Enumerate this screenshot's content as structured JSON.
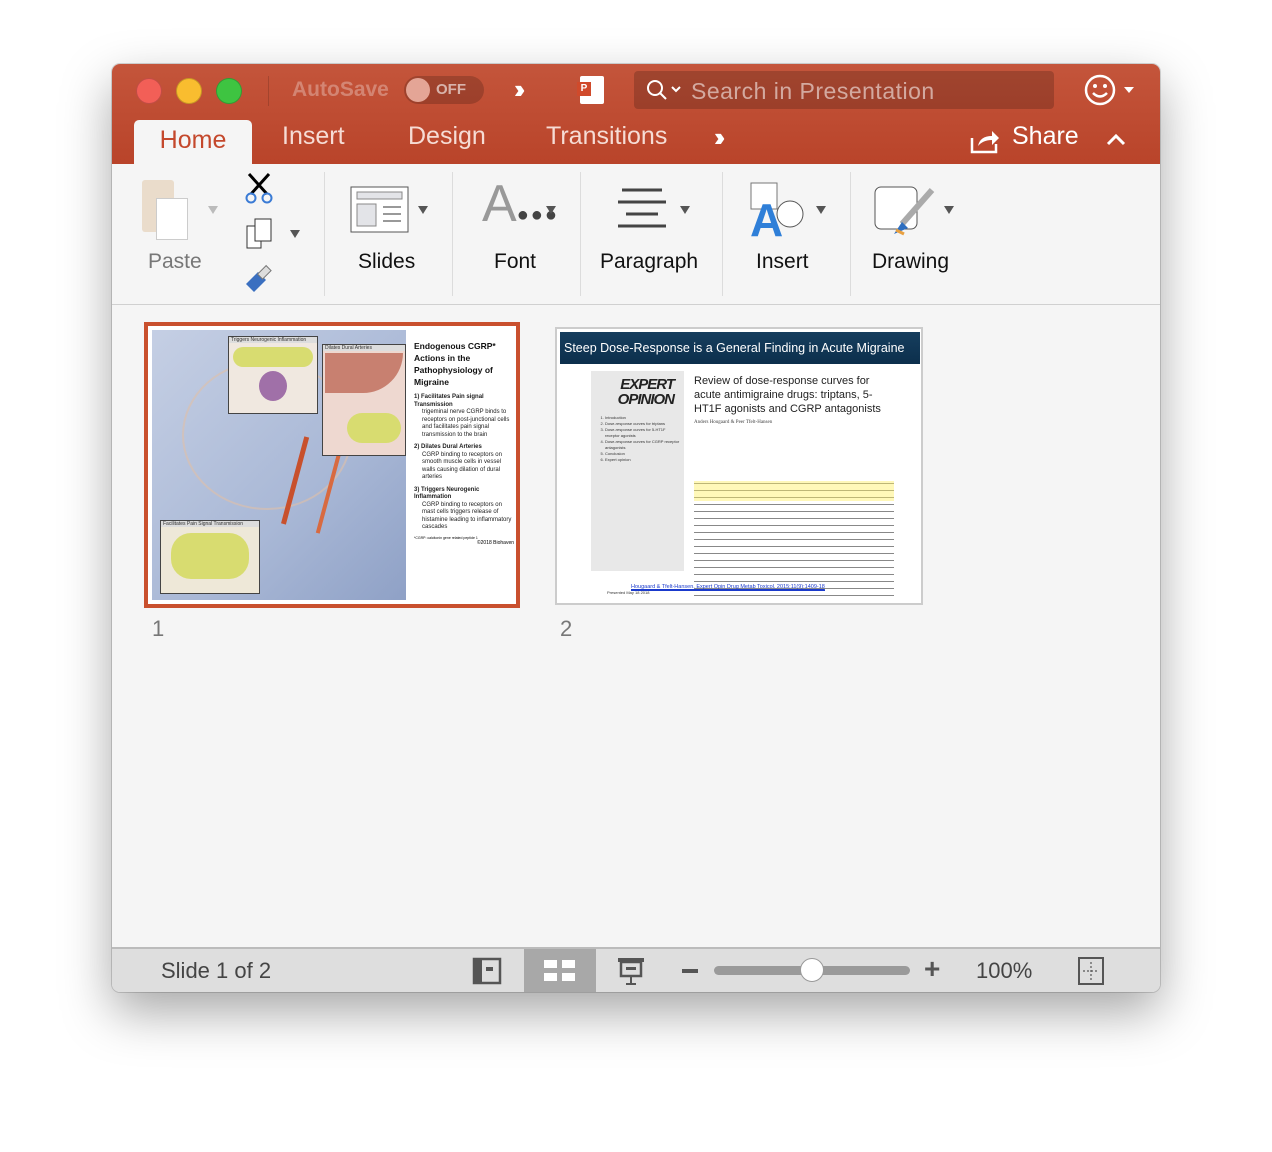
{
  "titlebar": {
    "autosave_label": "AutoSave",
    "autosave_state": "OFF",
    "search_placeholder": "Search in Presentation"
  },
  "tabs": [
    {
      "label": "Home",
      "active": true
    },
    {
      "label": "Insert"
    },
    {
      "label": "Design"
    },
    {
      "label": "Transitions"
    }
  ],
  "share_label": "Share",
  "ribbon": {
    "paste": "Paste",
    "slides": "Slides",
    "font": "Font",
    "paragraph": "Paragraph",
    "insert": "Insert",
    "drawing": "Drawing"
  },
  "slides": [
    {
      "number": "1",
      "selected": true,
      "title": "Endogenous CGRP* Actions in the Pathophysiology of Migraine",
      "points": [
        {
          "head": "1) Facilitates Pain signal Transmission",
          "body": "trigeminal nerve CGRP binds to receptors on post-junctional cells and facilitates pain signal transmission to the brain"
        },
        {
          "head": "2) Dilates Dural Arteries",
          "body": "CGRP binding to receptors on smooth muscle cells in vessel walls causing dilation of dural arteries"
        },
        {
          "head": "3) Triggers Neurogenic Inflammation",
          "body": "CGRP binding to receptors on mast cells triggers release of histamine leading to inflammatory cascades"
        }
      ],
      "insets": [
        "Triggers Neurogenic Inflammation",
        "Dilates Dural Arteries",
        "Facilitates Pain Signal Transmission"
      ],
      "footnote": "*CGRP: calcitonin gene related peptide 1",
      "copyright": "©2018 Biohaven"
    },
    {
      "number": "2",
      "header": "Steep Dose-Response is a General Finding in Acute Migraine",
      "journal": "EXPERT OPINION",
      "toc": [
        "Introduction",
        "Dose-response curves for triptans",
        "Dose-response curves for 5-HT1F receptor agonists",
        "Dose-response curves for CGRP receptor antagonists",
        "Conclusion",
        "Expert opinion"
      ],
      "article_title": "Review of dose-response curves for acute antimigraine drugs: triptans, 5-HT1F agonists and CGRP antagonists",
      "authors": "Anders Hougaard & Peer Tfelt-Hansen",
      "citation": "Hougaard & Tfelt-Hansen. Expert Opin Drug Metab Toxicol. 2015;11(9):1409-18",
      "presented": "Presented May 18 2018"
    }
  ],
  "status": {
    "slide_indicator": "Slide 1 of 2",
    "zoom": "100%",
    "zoom_level": 0.5
  },
  "colors": {
    "accent": "#c4482c",
    "slide_header": "#0d3a5c"
  }
}
